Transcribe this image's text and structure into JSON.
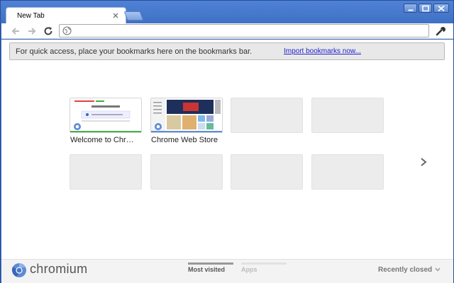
{
  "window": {
    "colors": {
      "frame": "#3b6cc0",
      "accent_link": "#2222cc"
    }
  },
  "tabs": [
    {
      "title": "New Tab",
      "active": true
    }
  ],
  "toolbar": {
    "back_icon": "back-arrow-icon",
    "forward_icon": "forward-arrow-icon",
    "reload_icon": "reload-icon",
    "omnibox_value": "",
    "menu_icon": "wrench-icon"
  },
  "bookmark_bar": {
    "message": "For quick access, place your bookmarks here on the bookmarks bar.",
    "link": "Import bookmarks now..."
  },
  "most_visited": [
    {
      "title": "Welcome to Chr…",
      "filled": true
    },
    {
      "title": "Chrome Web Store",
      "filled": true
    },
    {
      "title": "",
      "filled": false
    },
    {
      "title": "",
      "filled": false
    },
    {
      "title": "",
      "filled": false
    },
    {
      "title": "",
      "filled": false
    },
    {
      "title": "",
      "filled": false
    },
    {
      "title": "",
      "filled": false
    }
  ],
  "footer": {
    "logo_text": "chromium",
    "tabs": [
      {
        "label": "Most visited",
        "selected": true
      },
      {
        "label": "Apps",
        "selected": false
      }
    ],
    "recently_closed": "Recently closed"
  }
}
